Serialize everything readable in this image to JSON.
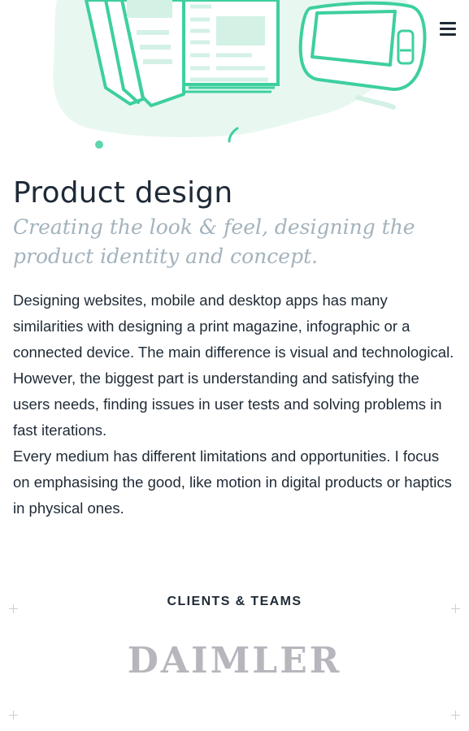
{
  "header": {
    "menu_icon": "hamburger-menu-icon"
  },
  "hero": {
    "illustration": "magazine-and-device-illustration",
    "colors": {
      "stroke": "#3ecf9f",
      "fill": "#e8f8f1",
      "panel": "#d3f1e5"
    }
  },
  "section": {
    "title": "Product design",
    "subtitle": "Creating the look & feel, designing the product identity and concept.",
    "paragraphs": [
      "Designing websites, mobile and desktop apps has many similarities with designing a print magazine, infographic or a connected device. The main difference is visual and technological. However, the biggest part is understanding and satisfying the users needs, finding issues in user tests and solving problems in fast iterations.",
      "Every medium has different limitations and opportunities. I focus on emphasising the good, like motion in digital products or haptics in physical ones."
    ]
  },
  "clients": {
    "heading": "CLIENTS & TEAMS",
    "logos": [
      {
        "name": "DAIMLER"
      }
    ]
  }
}
